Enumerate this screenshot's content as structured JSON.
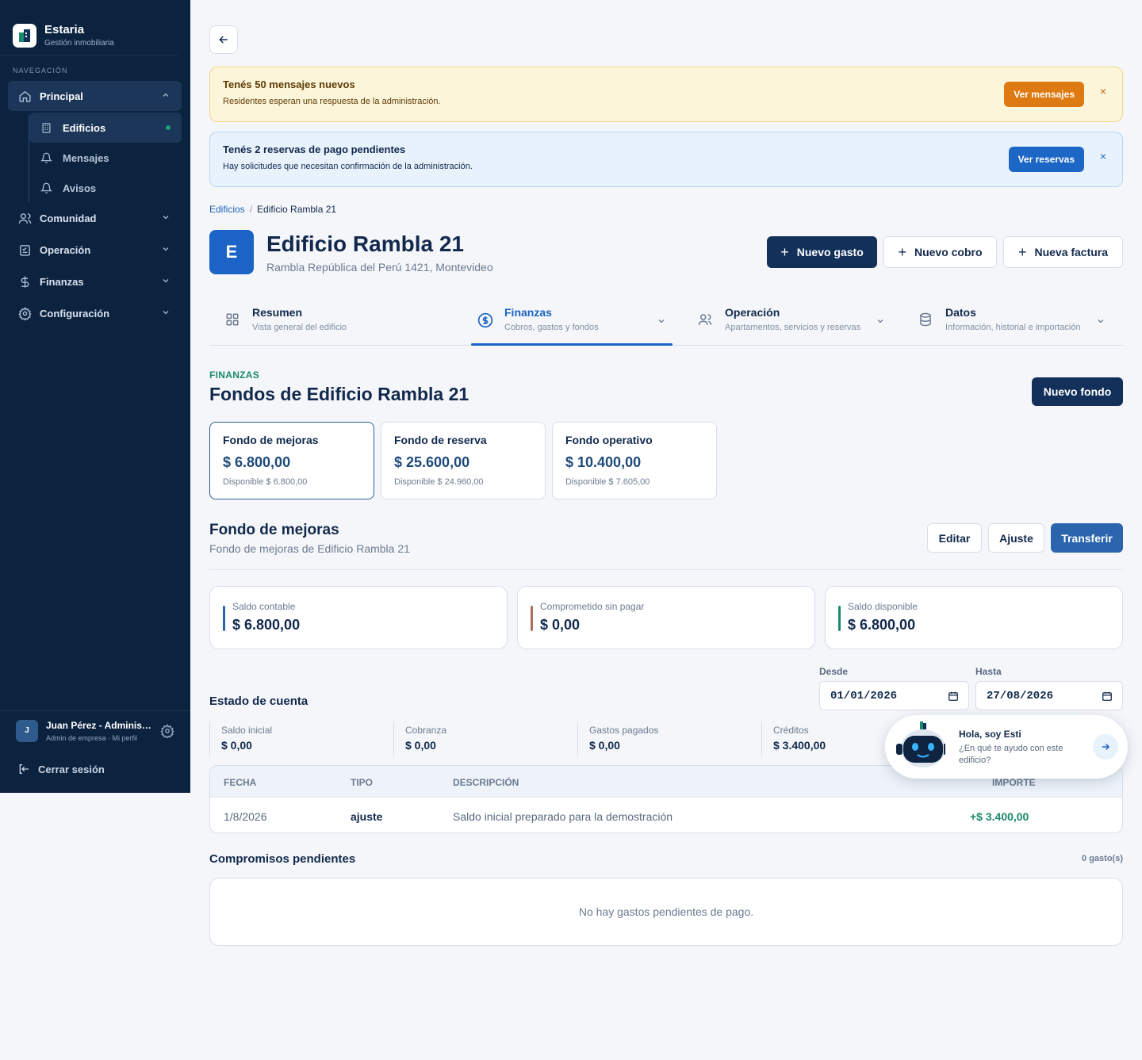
{
  "brand": {
    "name": "Estaria",
    "subtitle": "Gestión inmobiliaria"
  },
  "sidebar": {
    "nav_label": "NAVEGACIÓN",
    "principal": "Principal",
    "sub_items": [
      "Edificios",
      "Mensajes",
      "Avisos"
    ],
    "sections": [
      "Comunidad",
      "Operación",
      "Finanzas",
      "Configuración"
    ],
    "user_initial": "J",
    "user_name": "Juan Pérez - Administrador",
    "user_role": "Admin de empresa · Mi perfil",
    "logout": "Cerrar sesión"
  },
  "alerts": [
    {
      "title": "Tenés 50 mensajes nuevos",
      "desc": "Residentes esperan una respuesta de la administración.",
      "button": "Ver mensajes",
      "close": "×"
    },
    {
      "title": "Tenés 2 reservas de pago pendientes",
      "desc": "Hay solicitudes que necesitan confirmación de la administración.",
      "button": "Ver reservas",
      "close": "×"
    }
  ],
  "breadcrumb": {
    "root": "Edificios",
    "sep": "/",
    "current": "Edificio Rambla 21"
  },
  "building": {
    "initial": "E",
    "name": "Edificio Rambla 21",
    "address": "Rambla República del Perú 1421, Montevideo"
  },
  "header_actions": {
    "plus": "+",
    "new_expense": "Nuevo gasto",
    "new_charge": "Nuevo cobro",
    "new_invoice": "Nueva factura"
  },
  "tabs": [
    {
      "title": "Resumen",
      "subtitle": "Vista general del edificio"
    },
    {
      "title": "Finanzas",
      "subtitle": "Cobros, gastos y fondos"
    },
    {
      "title": "Operación",
      "subtitle": "Apartamentos, servicios y reservas"
    },
    {
      "title": "Datos",
      "subtitle": "Información, historial e importación"
    }
  ],
  "section": {
    "kicker": "FINANZAS",
    "title": "Fondos de Edificio Rambla 21",
    "new_fund": "Nuevo fondo"
  },
  "funds": [
    {
      "name": "Fondo de mejoras",
      "value": "$ 6.800,00",
      "available": "Disponible $ 6.800,00"
    },
    {
      "name": "Fondo de reserva",
      "value": "$ 25.600,00",
      "available": "Disponible $ 24.960,00"
    },
    {
      "name": "Fondo operativo",
      "value": "$ 10.400,00",
      "available": "Disponible $ 7.605,00"
    }
  ],
  "fund_detail": {
    "title": "Fondo de mejoras",
    "subtitle": "Fondo de mejoras de Edificio Rambla 21",
    "edit": "Editar",
    "adjust": "Ajuste",
    "transfer": "Transferir"
  },
  "balances": [
    {
      "label": "Saldo contable",
      "value": "$ 6.800,00",
      "color": "#2a65ad"
    },
    {
      "label": "Comprometido sin pagar",
      "value": "$ 0,00",
      "color": "#a8715f"
    },
    {
      "label": "Saldo disponible",
      "value": "$ 6.800,00",
      "color": "#1a8a6c"
    }
  ],
  "statement": {
    "title": "Estado de cuenta",
    "from_label": "Desde",
    "from": "01/01/2026",
    "to_label": "Hasta",
    "to": "27/08/2026",
    "stats": [
      {
        "label": "Saldo inicial",
        "value": "$ 0,00"
      },
      {
        "label": "Cobranza",
        "value": "$ 0,00"
      },
      {
        "label": "Gastos pagados",
        "value": "$ 0,00"
      },
      {
        "label": "Créditos",
        "value": "$ 3.400,00"
      }
    ],
    "columns": [
      "FECHA",
      "TIPO",
      "DESCRIPCIÓN",
      "IMPORTE"
    ],
    "rows": [
      {
        "date": "1/8/2026",
        "type": "ajuste",
        "description": "Saldo inicial preparado para la demostración",
        "amount": "+$ 3.400,00"
      }
    ]
  },
  "commitments": {
    "title": "Compromisos pendientes",
    "count": "0 gasto(s)",
    "empty": "No hay gastos pendientes de pago."
  },
  "assistant": {
    "greeting": "Hola, soy Esti",
    "prompt": "¿En qué te ayudo con este edificio?"
  }
}
